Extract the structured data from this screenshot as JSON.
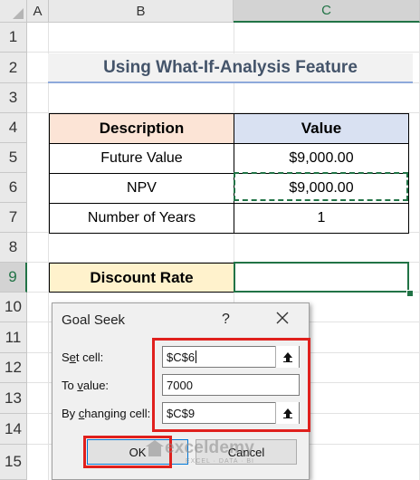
{
  "sheet": {
    "columns": [
      "A",
      "B",
      "C"
    ],
    "rows": [
      "1",
      "2",
      "3",
      "4",
      "5",
      "6",
      "7",
      "8",
      "9",
      "10",
      "11",
      "12",
      "13",
      "14",
      "15"
    ],
    "title": "Using What-If-Analysis Feature",
    "table": {
      "header_description": "Description",
      "header_value": "Value",
      "rows": [
        {
          "description": "Future Value",
          "value": "$9,000.00"
        },
        {
          "description": "NPV",
          "value": "$9,000.00"
        },
        {
          "description": "Number of Years",
          "value": "1"
        }
      ]
    },
    "discount_rate_label": "Discount Rate",
    "discount_rate_value": ""
  },
  "dialog": {
    "title": "Goal Seek",
    "help": "?",
    "set_cell_label_pre": "S",
    "set_cell_label_u": "e",
    "set_cell_label_post": "t cell:",
    "set_cell_value": "$C$6",
    "to_value_label_pre": "To ",
    "to_value_label_u": "v",
    "to_value_label_post": "alue:",
    "to_value_value": "7000",
    "changing_label_pre": "By ",
    "changing_label_u": "c",
    "changing_label_post": "hanging cell:",
    "changing_value": "$C$9",
    "ok_label": "OK",
    "cancel_label": "Cancel"
  },
  "watermark": {
    "brand": "exceldemy",
    "tagline": "EXCEL · DATA · BI"
  },
  "colors": {
    "header_fill_description": "#fce4d6",
    "header_fill_value": "#d9e1f2",
    "discount_fill": "#fff2cc",
    "accent_green": "#217346",
    "highlight_red": "#e0201d"
  }
}
